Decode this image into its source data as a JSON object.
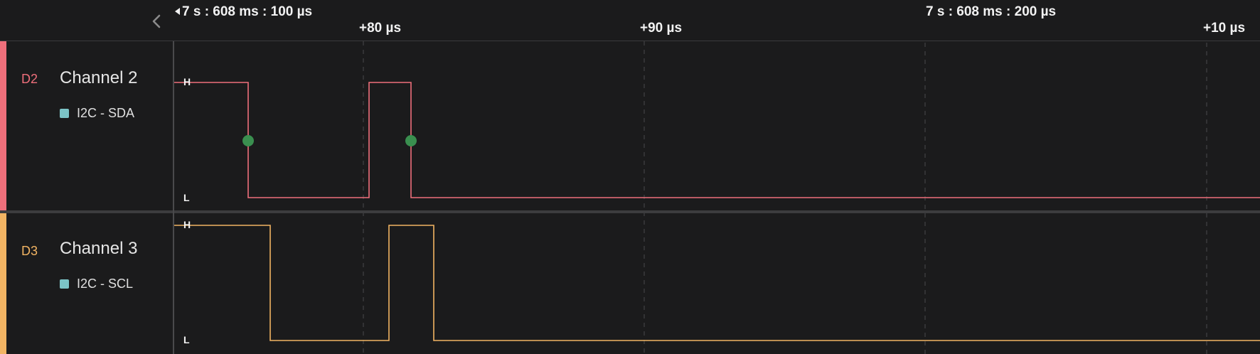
{
  "timeline": {
    "ref_time_1": "7 s : 608 ms : 100 µs",
    "ref_time_2": "7 s : 608 ms : 200 µs",
    "offset_1": "+80 µs",
    "offset_2": "+90 µs",
    "offset_3": "+10 µs"
  },
  "channels": [
    {
      "id": "D2",
      "name": "Channel 2",
      "analyzer": "I2C - SDA",
      "color": "#ef6f7b",
      "high_label": "H",
      "low_label": "L"
    },
    {
      "id": "D3",
      "name": "Channel 3",
      "analyzer": "I2C - SCL",
      "color": "#f2b463",
      "high_label": "H",
      "low_label": "L"
    }
  ],
  "colors": {
    "background": "#1b1b1c",
    "analyzer_swatch": "#7cc4c7",
    "marker_dot": "#3a8f4f",
    "grid": "#4a4a4c"
  },
  "icons": {
    "collapse": "chevron-left-icon",
    "reference": "triangle-left-icon",
    "marker": "circle-icon"
  }
}
